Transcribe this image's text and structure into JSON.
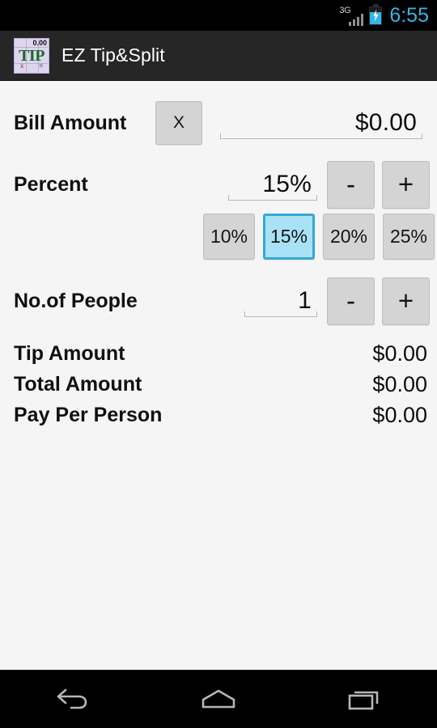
{
  "status_bar": {
    "network_label": "3G",
    "signal_icon": "signal-bars-icon",
    "battery_icon": "battery-charging-icon",
    "time": "6:55",
    "accent_color": "#33b5e5"
  },
  "action_bar": {
    "app_icon": {
      "name": "app-icon",
      "top_number": "0.00",
      "word": "TIP",
      "mark_left": "x",
      "mark_right": "=",
      "background": "#ded6ef",
      "word_color": "#1a6b2a"
    },
    "title": "EZ Tip&Split",
    "background": "#262626"
  },
  "form": {
    "bill": {
      "label": "Bill Amount",
      "clear_button": "X",
      "value": "$0.00",
      "placeholder": "$0.00"
    },
    "percent": {
      "label": "Percent",
      "value": "15%",
      "placeholder": "15%",
      "decrement": "-",
      "increment": "+",
      "presets": [
        {
          "label": "10%",
          "selected": false
        },
        {
          "label": "15%",
          "selected": true
        },
        {
          "label": "20%",
          "selected": false
        },
        {
          "label": "25%",
          "selected": false
        }
      ],
      "selected_fill": "#a9e2f6",
      "selected_border": "#34a8d8"
    },
    "people": {
      "label": "No.of People",
      "value": "1",
      "placeholder": "1",
      "decrement": "-",
      "increment": "+"
    }
  },
  "results": [
    {
      "label": "Tip Amount",
      "value": "$0.00"
    },
    {
      "label": "Total Amount",
      "value": "$0.00"
    },
    {
      "label": "Pay Per Person",
      "value": "$0.00"
    }
  ],
  "nav_bar": {
    "back": "back-icon",
    "home": "home-icon",
    "recents": "recents-icon"
  }
}
